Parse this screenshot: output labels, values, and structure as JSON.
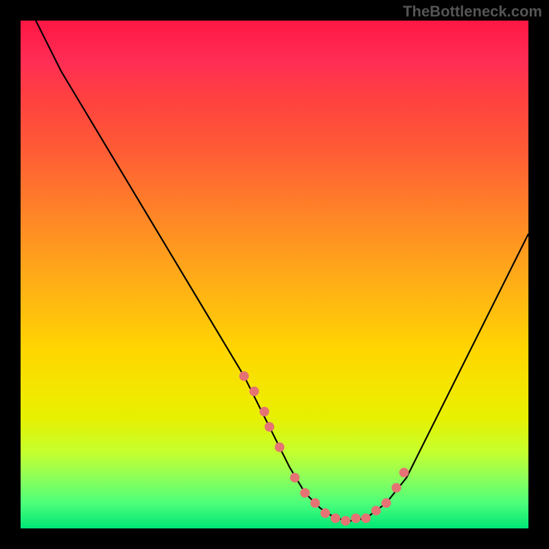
{
  "watermark": "TheBottleneck.com",
  "chart_data": {
    "type": "line",
    "title": "",
    "xlabel": "",
    "ylabel": "",
    "xlim": [
      0,
      100
    ],
    "ylim": [
      0,
      100
    ],
    "series": [
      {
        "name": "curve",
        "x": [
          3,
          8,
          14,
          20,
          26,
          32,
          38,
          44,
          49,
          53,
          56,
          59,
          62,
          65,
          68,
          72,
          76,
          80,
          84,
          88,
          92,
          96,
          100
        ],
        "y": [
          100,
          90,
          80,
          70,
          60,
          50,
          40,
          30,
          20,
          12,
          7,
          4,
          2,
          1.5,
          2,
          5,
          10,
          18,
          26,
          34,
          42,
          50,
          58
        ]
      }
    ],
    "markers": {
      "name": "dots",
      "color": "#e57373",
      "x": [
        44,
        46,
        48,
        49,
        51,
        54,
        56,
        58,
        60,
        62,
        64,
        66,
        68,
        70,
        72,
        74,
        75.5
      ],
      "y": [
        30,
        27,
        23,
        20,
        16,
        10,
        7,
        5,
        3,
        2,
        1.5,
        2,
        2,
        3.5,
        5,
        8,
        11
      ]
    },
    "gradient_stops": [
      {
        "pos": 0,
        "color": "#ff1744"
      },
      {
        "pos": 25,
        "color": "#ff5a36"
      },
      {
        "pos": 55,
        "color": "#ffb812"
      },
      {
        "pos": 78,
        "color": "#e8f000"
      },
      {
        "pos": 100,
        "color": "#00e676"
      }
    ]
  }
}
